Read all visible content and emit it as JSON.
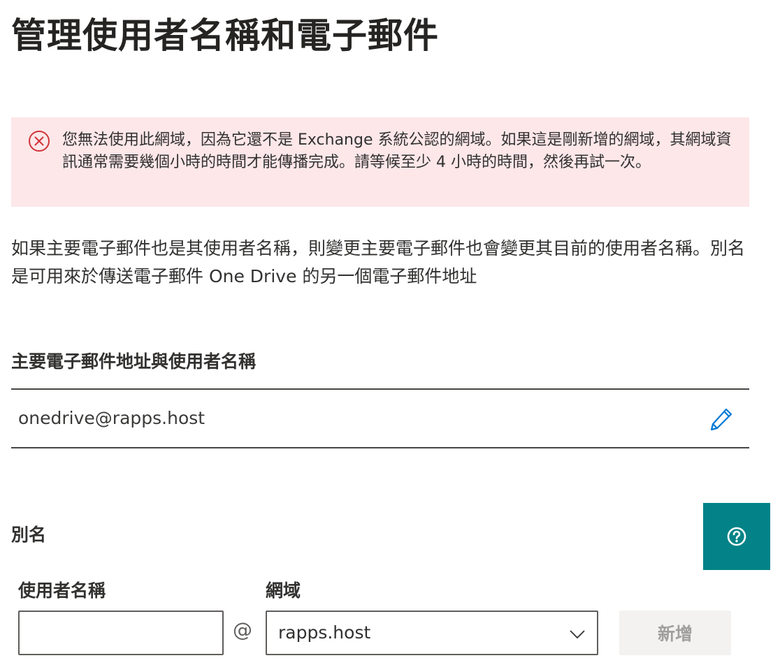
{
  "page": {
    "title": "管理使用者名稱和電子郵件"
  },
  "error": {
    "icon": "error-circle-icon",
    "color": "#d13438",
    "message": "您無法使用此網域，因為它還不是 Exchange 系統公認的網域。如果這是剛新增的網域，其網域資訊通常需要幾個小時的時間才能傳播完成。請等候至少 4 小時的時間，然後再試一次。"
  },
  "description": "如果主要電子郵件也是其使用者名稱，則變更主要電子郵件也會變更其目前的使用者名稱。別名是可用來於傳送電子郵件 One Drive 的另一個電子郵件地址",
  "primary": {
    "heading": "主要電子郵件地址與使用者名稱",
    "value": "onedrive@rapps.host",
    "edit_icon": "pencil-icon"
  },
  "alias": {
    "heading": "別名",
    "username_label": "使用者名稱",
    "username_value": "",
    "at_sign": "@",
    "domain_label": "網域",
    "domain_selected": "rapps.host",
    "add_label": "新增"
  },
  "help": {
    "icon": "question-circle-icon",
    "color": "#038387"
  }
}
